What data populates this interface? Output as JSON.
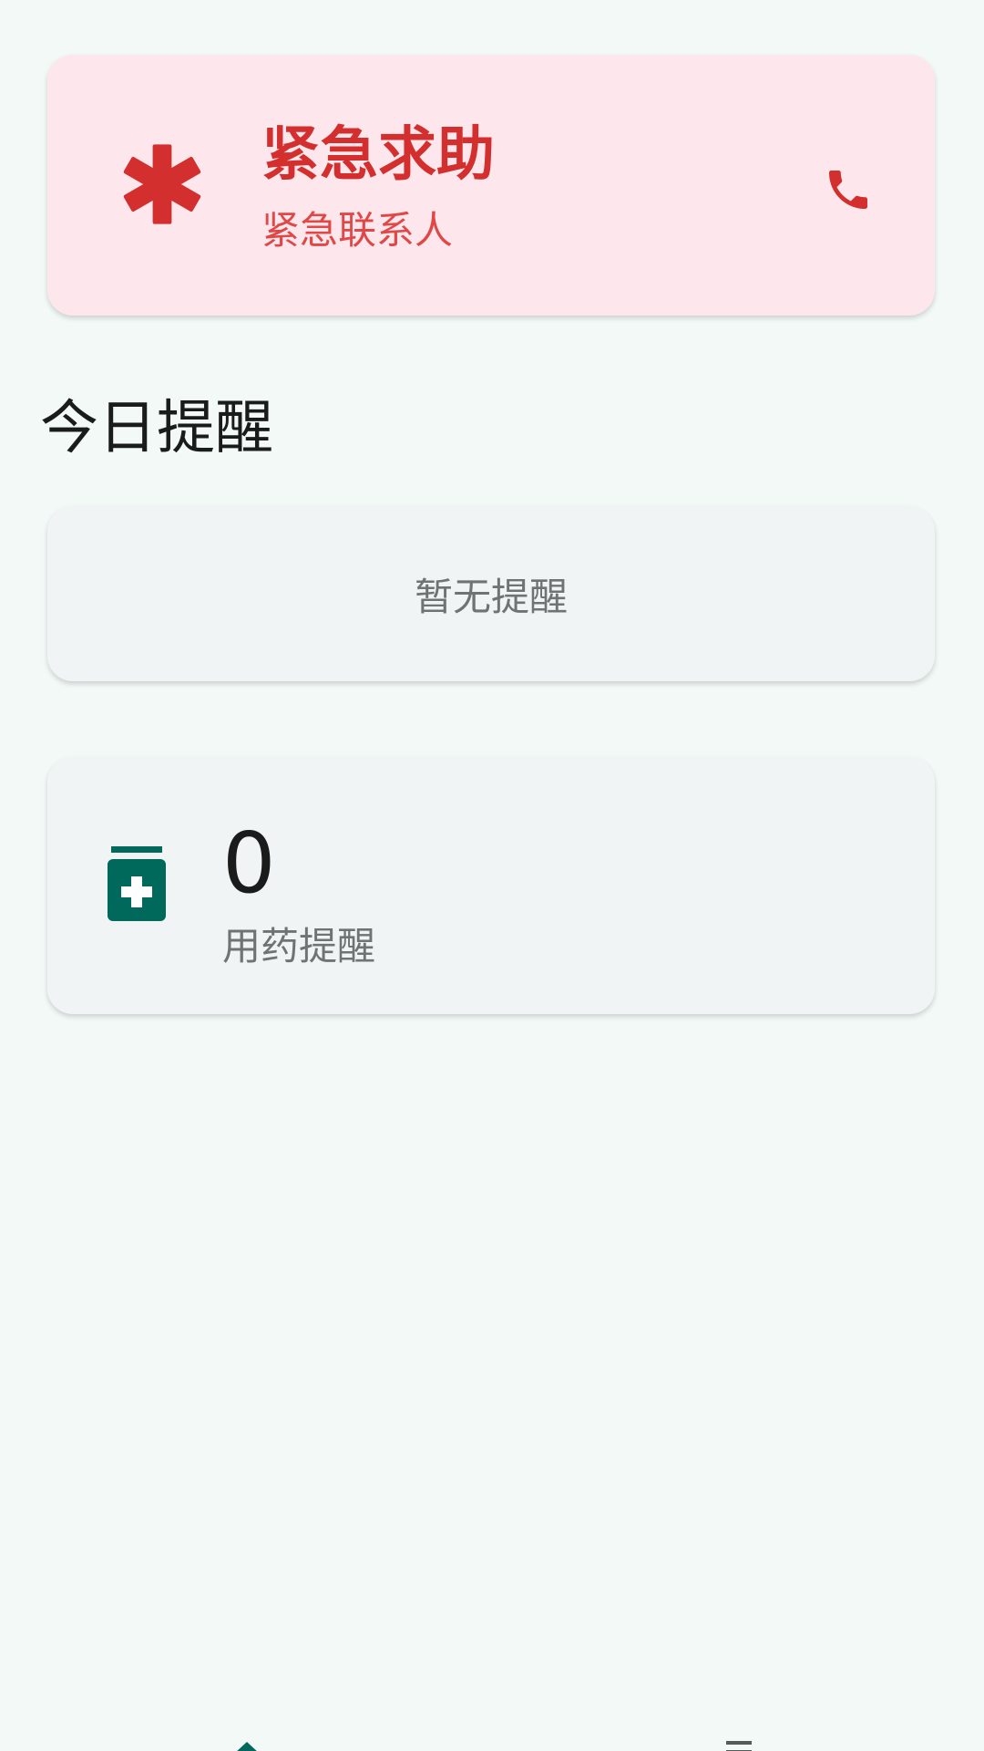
{
  "emergency": {
    "title": "紧急求助",
    "subtitle": "紧急联系人",
    "icon": "medical-asterisk-icon",
    "call_icon": "phone-icon",
    "accent_color": "#d32f2f",
    "background_color": "#fde7ec"
  },
  "reminders": {
    "section_title": "今日提醒",
    "empty_text": "暂无提醒"
  },
  "medication": {
    "count": "0",
    "label": "用药提醒",
    "icon": "medicine-bottle-icon",
    "icon_color": "#00695c"
  },
  "bottom_nav": {
    "items": [
      {
        "icon": "home-icon",
        "selected": true
      },
      {
        "icon": "list-icon",
        "selected": false
      }
    ]
  }
}
